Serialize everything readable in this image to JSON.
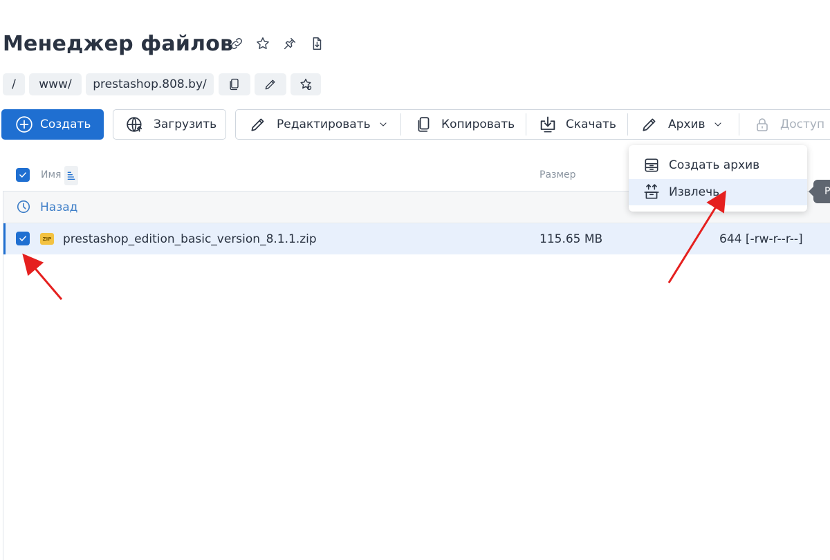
{
  "header": {
    "title": "Менеджер файлов",
    "icons": [
      "link-icon",
      "star-icon",
      "pin-icon",
      "file-download-icon"
    ]
  },
  "breadcrumb": {
    "items": [
      "/",
      "www/",
      "prestashop.808.by/"
    ],
    "action_icons": [
      "copy-icon",
      "pencil-icon",
      "star-outline-icon"
    ]
  },
  "toolbar": {
    "create_label": "Создать",
    "upload_label": "Загрузить",
    "edit_label": "Редактировать",
    "copy_label": "Копировать",
    "download_label": "Скачать",
    "archive_label": "Архив",
    "access_label": "Доступ"
  },
  "archive_menu": {
    "create_archive_label": "Создать архив",
    "extract_label": "Извлечь"
  },
  "tooltip": {
    "text": "Р"
  },
  "table": {
    "columns": {
      "name": "Имя",
      "size": "Размер"
    },
    "back_label": "Назад",
    "rows": [
      {
        "name": "prestashop_edition_basic_version_8.1.1.zip",
        "file_badge": "ZIP",
        "size": "115.65 MB",
        "permissions": "644 [-rw-r--r--]",
        "selected": true
      }
    ]
  },
  "colors": {
    "primary": "#1f6fd1",
    "selected_row": "#e8f0fc",
    "annotation_arrow": "#e5201f"
  }
}
